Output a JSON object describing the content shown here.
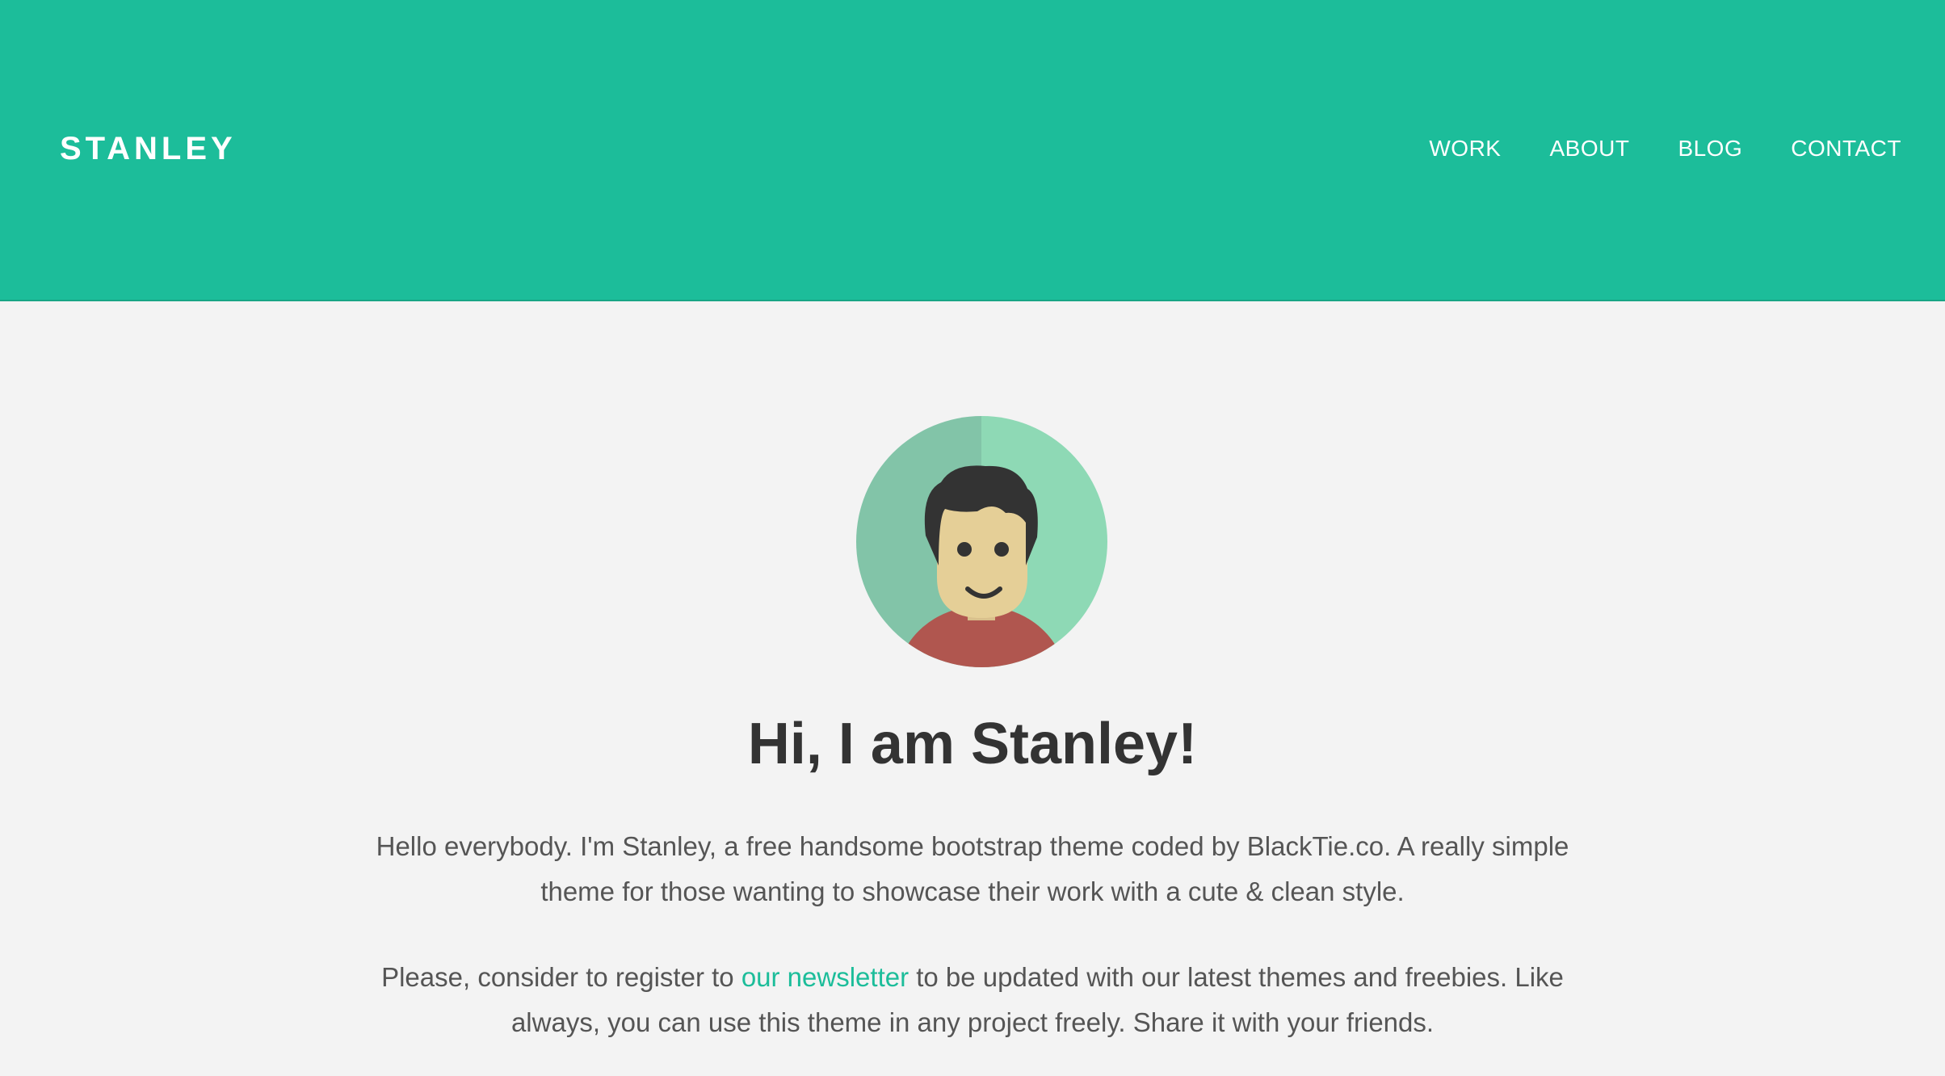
{
  "header": {
    "brand": "STANLEY",
    "nav": [
      "WORK",
      "ABOUT",
      "BLOG",
      "CONTACT"
    ],
    "bg_color": "#1cbd9a"
  },
  "hero": {
    "avatar_icon": "avatar-illustration",
    "title": "Hi, I am Stanley!",
    "intro": "Hello everybody. I'm Stanley, a free handsome bootstrap theme coded by BlackTie.co. A really simple theme for those wanting to showcase their work with a cute & clean style.",
    "newsletter_before": "Please, consider to register to ",
    "newsletter_link": "our newsletter",
    "newsletter_after": " to be updated with our latest themes and freebies. Like always, you can use this theme in any project freely. Share it with your friends.",
    "link_color": "#1cbd9a"
  }
}
